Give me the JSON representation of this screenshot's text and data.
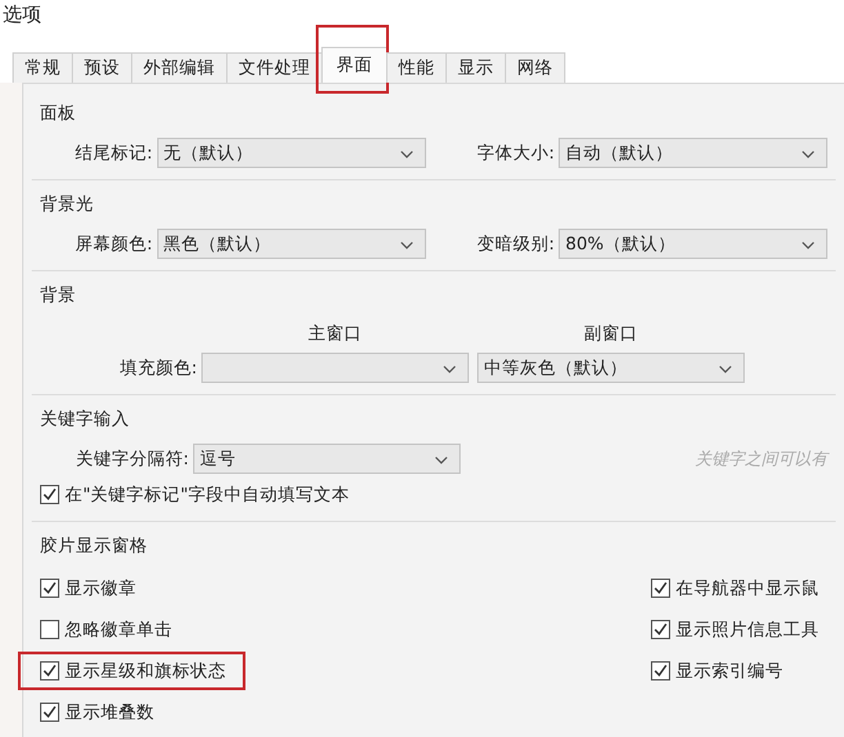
{
  "window": {
    "title": "选项"
  },
  "tabs": [
    {
      "label": "常规",
      "selected": false,
      "highlighted": false
    },
    {
      "label": "预设",
      "selected": false,
      "highlighted": false
    },
    {
      "label": "外部编辑",
      "selected": false,
      "highlighted": false
    },
    {
      "label": "文件处理",
      "selected": false,
      "highlighted": false
    },
    {
      "label": "界面",
      "selected": true,
      "highlighted": true
    },
    {
      "label": "性能",
      "selected": false,
      "highlighted": false
    },
    {
      "label": "显示",
      "selected": false,
      "highlighted": false
    },
    {
      "label": "网络",
      "selected": false,
      "highlighted": false
    }
  ],
  "sections": [
    {
      "title": "面板",
      "kind": "pair",
      "fields": [
        {
          "label": "结尾标记:",
          "value": "无（默认）"
        },
        {
          "label": "字体大小:",
          "value": "自动（默认）"
        }
      ]
    },
    {
      "title": "背景光",
      "kind": "pair",
      "fields": [
        {
          "label": "屏幕颜色:",
          "value": "黑色（默认）"
        },
        {
          "label": "变暗级别:",
          "value": "80%（默认）"
        }
      ]
    },
    {
      "title": "背景",
      "kind": "columns",
      "label": "填充颜色:",
      "selects": [
        {
          "column": "主窗口"
        },
        {
          "column": "副窗口",
          "value": "中等灰色（默认）"
        }
      ]
    },
    {
      "title": "关键字输入",
      "kind": "keyword",
      "label": "关键字分隔符:",
      "value": "逗号",
      "hint": "关键字之间可以有",
      "checkbox": {
        "label": "在\"关键字标记\"字段中自动填写文本",
        "checked": true
      }
    },
    {
      "title": "胶片显示窗格",
      "kind": "checks",
      "left": [
        {
          "label": "显示徽章",
          "checked": true,
          "highlighted": false
        },
        {
          "label": "忽略徽章单击",
          "checked": false,
          "highlighted": false
        },
        {
          "label": "显示星级和旗标状态",
          "checked": true,
          "highlighted": true
        },
        {
          "label": "显示堆叠数",
          "checked": true,
          "highlighted": false
        }
      ],
      "right": [
        {
          "label": "在导航器中显示鼠",
          "checked": true,
          "highlighted": false
        },
        {
          "label": "显示照片信息工具",
          "checked": true,
          "highlighted": false
        },
        {
          "label": "显示索引编号",
          "checked": true,
          "highlighted": false
        }
      ]
    }
  ]
}
